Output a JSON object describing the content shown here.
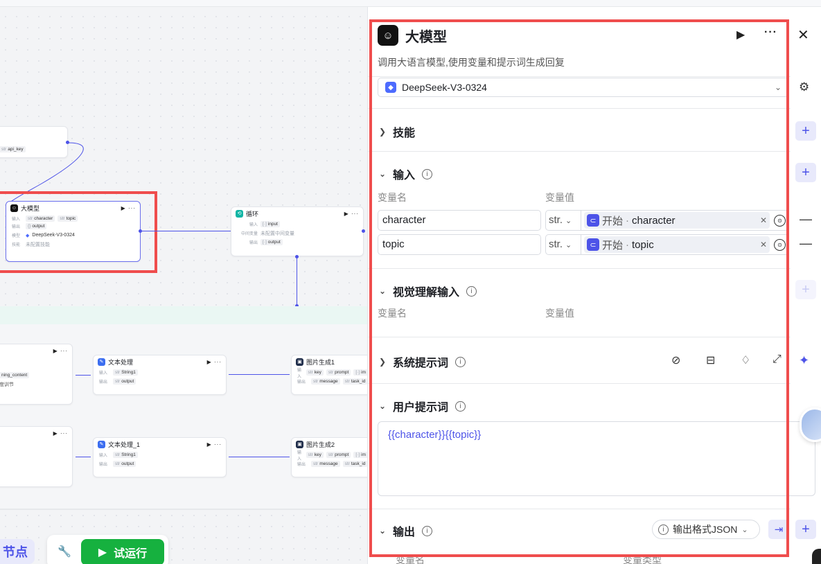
{
  "canvas": {
    "nodes": {
      "api": {
        "output": "api_key"
      },
      "llm": {
        "title": "大模型",
        "input_label": "输入",
        "inputs": [
          "character",
          "topic"
        ],
        "output_label": "输出",
        "output": "output",
        "model_label": "模型",
        "model": "DeepSeek-V3-0324",
        "skill_label": "技能",
        "skill": "未配置技能"
      },
      "loop": {
        "title": "循环",
        "input_label": "输入",
        "input": "input",
        "mid_label": "中间变量",
        "mid": "未配置中间变量",
        "output_label": "输出",
        "output": "output"
      },
      "left_a": {
        "line1": "ning_content",
        "line2": "度训节"
      },
      "text1": {
        "title": "文本处理",
        "input_label": "输入",
        "input": "String1",
        "output_label": "输出",
        "output": "output"
      },
      "text2": {
        "title": "文本处理_1",
        "input_label": "输入",
        "input": "String1",
        "output_label": "输出",
        "output": "output"
      },
      "img1": {
        "title": "图片生成1",
        "input_label": "输入",
        "inputs": [
          "key",
          "prompt",
          "im"
        ],
        "output_label": "输出",
        "outputs": [
          "message",
          "task_id"
        ]
      },
      "img2": {
        "title": "图片生成2",
        "input_label": "输入",
        "inputs": [
          "key",
          "prompt",
          "im"
        ],
        "output_label": "输出",
        "outputs": [
          "message",
          "task_id"
        ]
      }
    },
    "add_node_label": "节点",
    "run_label": "试运行"
  },
  "panel": {
    "title": "大模型",
    "description": "调用大语言模型,使用变量和提示词生成回复",
    "model": "DeepSeek-V3-0324",
    "sections": {
      "skills": "技能",
      "inputs": "输入",
      "vision": "视觉理解输入",
      "system_prompt": "系统提示词",
      "user_prompt": "用户提示词",
      "output": "输出"
    },
    "col_name": "变量名",
    "col_value": "变量值",
    "col_type": "变量类型",
    "inputs": [
      {
        "name": "character",
        "type": "str.",
        "source": "开始",
        "ref": "character"
      },
      {
        "name": "topic",
        "type": "str.",
        "source": "开始",
        "ref": "topic"
      }
    ],
    "user_prompt": "{{character}}{{topic}}",
    "output_format": "输出格式JSON",
    "accent": "#4d53e8",
    "highlight": "#ef4d4d"
  }
}
